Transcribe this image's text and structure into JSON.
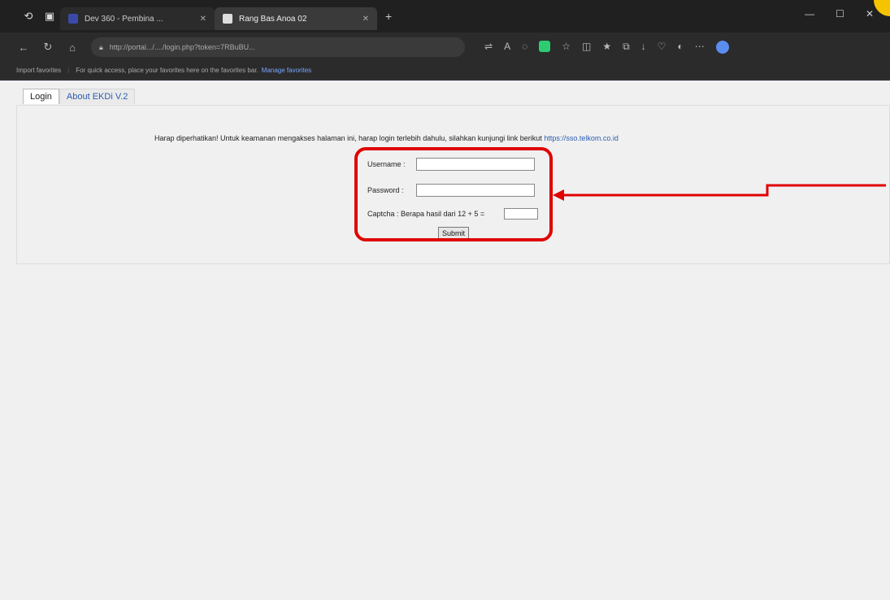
{
  "browser": {
    "tabs": [
      {
        "title": "Dev 360 - Pembina ...",
        "active": false
      },
      {
        "title": "Rang Bas Anoa 02",
        "active": false
      }
    ],
    "new_tab": "+",
    "address": "http://portal.../..../login.php?token=7RBuBU...",
    "favorites_bar_text": "For quick access, place your favorites here on the favorites bar.",
    "favorites_link": "Manage favorites",
    "import_label": "Import favorites"
  },
  "page": {
    "tabs": [
      "Login",
      "About EKDi V.2"
    ],
    "notice": "Harap diperhatikan! Untuk keamanan mengakses halaman ini, harap login terlebih dahulu, silahkan kunjungi link berikut",
    "notice_url": "https://sso.telkom.co.id"
  },
  "form": {
    "username_label": "Username :",
    "password_label": "Password :",
    "captcha_label": "Captcha : Berapa hasil dari 12 + 5 =",
    "submit_label": "Submit"
  },
  "annotation": {
    "highlight_color": "#e00000"
  }
}
